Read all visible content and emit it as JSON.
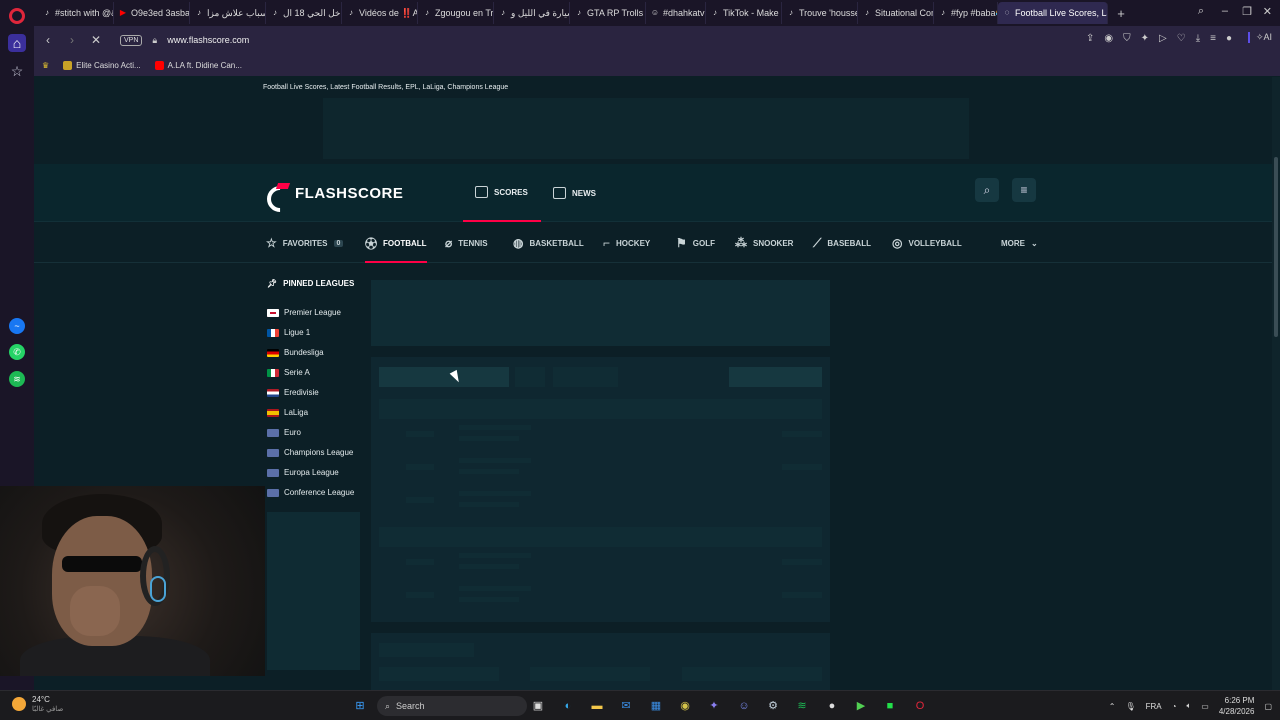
{
  "browser": {
    "tabs": [
      {
        "label": "#stitch with @&",
        "icon": "tiktok-icon",
        "active": false
      },
      {
        "label": "O9e3ed 3asba",
        "icon": "youtube-icon",
        "active": false
      },
      {
        "label": "أسباب علاش مزا",
        "icon": "tiktok-icon",
        "active": false
      },
      {
        "label": "داخل الحي 18 ال",
        "icon": "tiktok-icon",
        "active": false
      },
      {
        "label": "Vidéos de ‼️An",
        "icon": "tiktok-icon",
        "active": false
      },
      {
        "label": "Zgougou en Tra",
        "icon": "tiktok-icon",
        "active": false
      },
      {
        "label": "سيارة في الليل و",
        "icon": "tiktok-icon",
        "active": false
      },
      {
        "label": "GTA RP Trolls ar",
        "icon": "tiktok-icon",
        "active": false
      },
      {
        "label": "#dhahkatv",
        "icon": "emoji-icon",
        "active": false
      },
      {
        "label": "TikTok - Make Y",
        "icon": "tiktok-icon",
        "active": false
      },
      {
        "label": "Trouve 'houssen",
        "icon": "tiktok-icon",
        "active": false
      },
      {
        "label": "Situational Com",
        "icon": "tiktok-icon",
        "active": false
      },
      {
        "label": "#fyp #baba😂 🎯",
        "icon": "tiktok-icon",
        "active": false
      },
      {
        "label": "Football Live Scores, Lates",
        "icon": "loading-icon",
        "active": true
      }
    ],
    "address": {
      "vpn_label": "VPN",
      "url": "www.flashscore.com",
      "ai_label": "AI"
    },
    "bookmarks": [
      {
        "label": "Elite Casino Acti...",
        "icon_color": "#c9a227"
      },
      {
        "label": "A.LA ft. Didine Can...",
        "icon_color": "#ff0000"
      }
    ]
  },
  "page": {
    "title": "Football Live Scores, Latest Football Results, EPL, LaLiga, Champions League",
    "logo_text": "FLASHSCORE",
    "header_nav": [
      {
        "label": "SCORES",
        "active": true
      },
      {
        "label": "NEWS",
        "active": false
      }
    ],
    "sports_nav": [
      {
        "label": "FAVORITES",
        "count": "0",
        "icon": "star-icon",
        "active": false
      },
      {
        "label": "FOOTBALL",
        "icon": "football-icon",
        "active": true
      },
      {
        "label": "TENNIS",
        "icon": "tennis-icon",
        "active": false
      },
      {
        "label": "BASKETBALL",
        "icon": "basketball-icon",
        "active": false
      },
      {
        "label": "HOCKEY",
        "icon": "hockey-icon",
        "active": false
      },
      {
        "label": "GOLF",
        "icon": "golf-icon",
        "active": false
      },
      {
        "label": "SNOOKER",
        "icon": "snooker-icon",
        "active": false
      },
      {
        "label": "BASEBALL",
        "icon": "baseball-icon",
        "active": false
      },
      {
        "label": "VOLLEYBALL",
        "icon": "volleyball-icon",
        "active": false
      },
      {
        "label": "MORE",
        "icon": "chevron-down-icon",
        "active": false
      }
    ],
    "pinned_title": "PINNED LEAGUES",
    "leagues": [
      {
        "label": "Premier League",
        "flag": "england"
      },
      {
        "label": "Ligue 1",
        "flag": "france"
      },
      {
        "label": "Bundesliga",
        "flag": "germany"
      },
      {
        "label": "Serie A",
        "flag": "italy"
      },
      {
        "label": "Eredivisie",
        "flag": "netherlands"
      },
      {
        "label": "LaLiga",
        "flag": "spain"
      },
      {
        "label": "Euro",
        "flag": "europe"
      },
      {
        "label": "Champions League",
        "flag": "europe"
      },
      {
        "label": "Europa League",
        "flag": "europe"
      },
      {
        "label": "Conference League",
        "flag": "europe"
      }
    ]
  },
  "taskbar": {
    "weather_temp": "24°C",
    "weather_desc": "صافي غالبًا",
    "search_placeholder": "Search",
    "language": "FRA",
    "time": "6:26 PM",
    "date": "4/28/2026"
  },
  "colors": {
    "accent": "#ff0046",
    "page_bg": "#0c1f26",
    "header_bg": "#0a262d"
  }
}
